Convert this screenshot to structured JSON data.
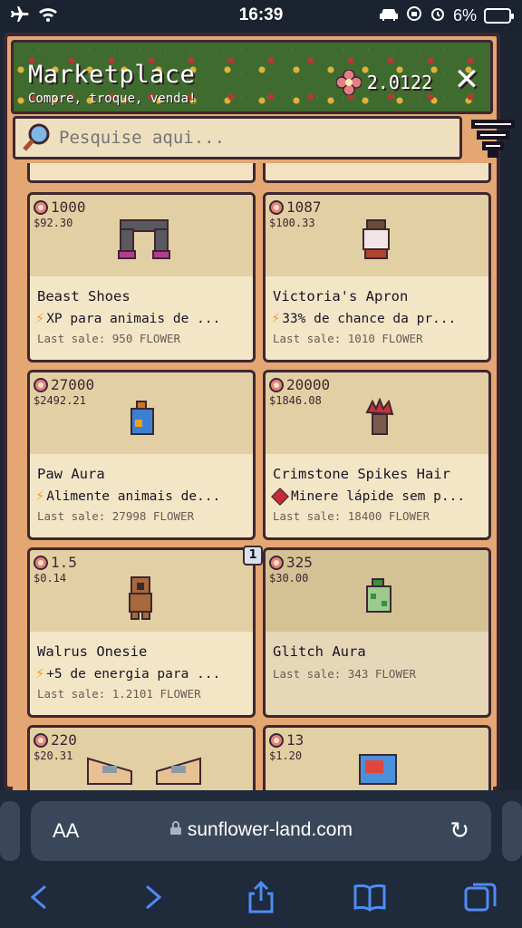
{
  "status_bar": {
    "time": "16:39",
    "battery": "6%"
  },
  "header": {
    "title": "Marketplace",
    "subtitle": "Compre, troque, venda!",
    "balance": "2.0122"
  },
  "search": {
    "placeholder": "Pesquise aqui..."
  },
  "items": [
    {
      "price": "1000",
      "usd": "$92.30",
      "name": "Beast Shoes",
      "boost_icon": "lightning-icon",
      "desc": "XP para animais de ...",
      "last_sale": "Last sale: 950 FLOWER"
    },
    {
      "price": "1087",
      "usd": "$100.33",
      "name": "Victoria's Apron",
      "boost_icon": "lightning-icon",
      "desc": "33% de chance da pr...",
      "last_sale": "Last sale: 1010 FLOWER"
    },
    {
      "price": "27000",
      "usd": "$2492.21",
      "name": "Paw Aura",
      "boost_icon": "lightning-icon",
      "desc": "Alimente animais de...",
      "last_sale": "Last sale: 27998 FLOWER"
    },
    {
      "price": "20000",
      "usd": "$1846.08",
      "name": "Crimstone Spikes Hair",
      "boost_icon": "crimstone-icon",
      "desc": "Minere lápide sem p...",
      "last_sale": "Last sale: 18400 FLOWER"
    },
    {
      "price": "1.5",
      "usd": "$0.14",
      "name": "Walrus Onesie",
      "boost_icon": "lightning-icon",
      "desc": "+5 de energia para ...",
      "last_sale": "Last sale: 1.2101 FLOWER",
      "owned_count": "1"
    },
    {
      "price": "325",
      "usd": "$30.00",
      "name": "Glitch Aura",
      "last_sale": "Last sale: 343 FLOWER"
    },
    {
      "price": "220",
      "usd": "$20.31"
    },
    {
      "price": "13",
      "usd": "$1.20"
    }
  ],
  "browser": {
    "aa_label": "AA",
    "url": "sunflower-land.com"
  },
  "colors": {
    "frame": "#e4a672",
    "card": "#f3e6c6",
    "outline": "#3e2731",
    "accent": "#4d8cf5"
  }
}
